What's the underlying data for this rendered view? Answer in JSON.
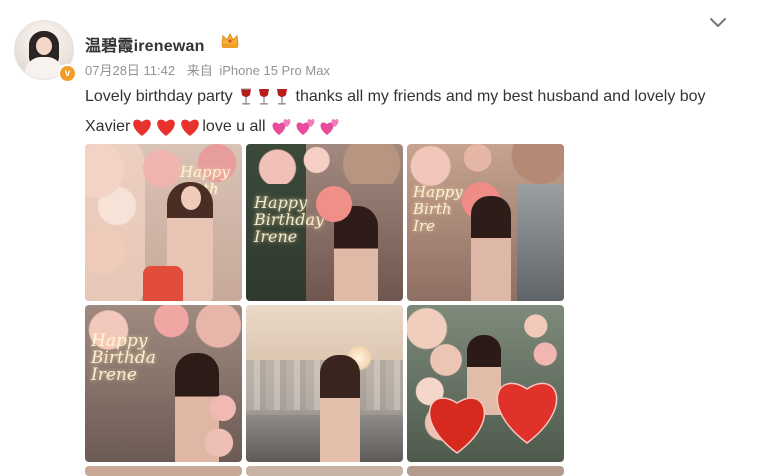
{
  "post": {
    "username": "温碧霞irenewan",
    "date": "07月28日 11:42",
    "source_prefix": "来自",
    "device": "iPhone 15 Pro Max",
    "text_part1": "Lovely birthday party",
    "text_part2": "thanks all my friends and my best husband and lovely boy Xavier",
    "text_part3": "love u all",
    "emojis": [
      "wine-glass",
      "wine-glass",
      "wine-glass",
      "red-heart",
      "red-heart",
      "red-heart",
      "two-hearts",
      "two-hearts",
      "two-hearts"
    ]
  },
  "photos": [
    {
      "label": "birthday photo 1"
    },
    {
      "label": "birthday photo 2"
    },
    {
      "label": "birthday photo 3"
    },
    {
      "label": "birthday photo 4"
    },
    {
      "label": "birthday photo 5"
    },
    {
      "label": "birthday photo 6"
    }
  ],
  "colors": {
    "accent_orange": "#f39b24",
    "meta_gray": "#939393",
    "heart_red": "#e8322e",
    "pink": "#e84c9b"
  }
}
